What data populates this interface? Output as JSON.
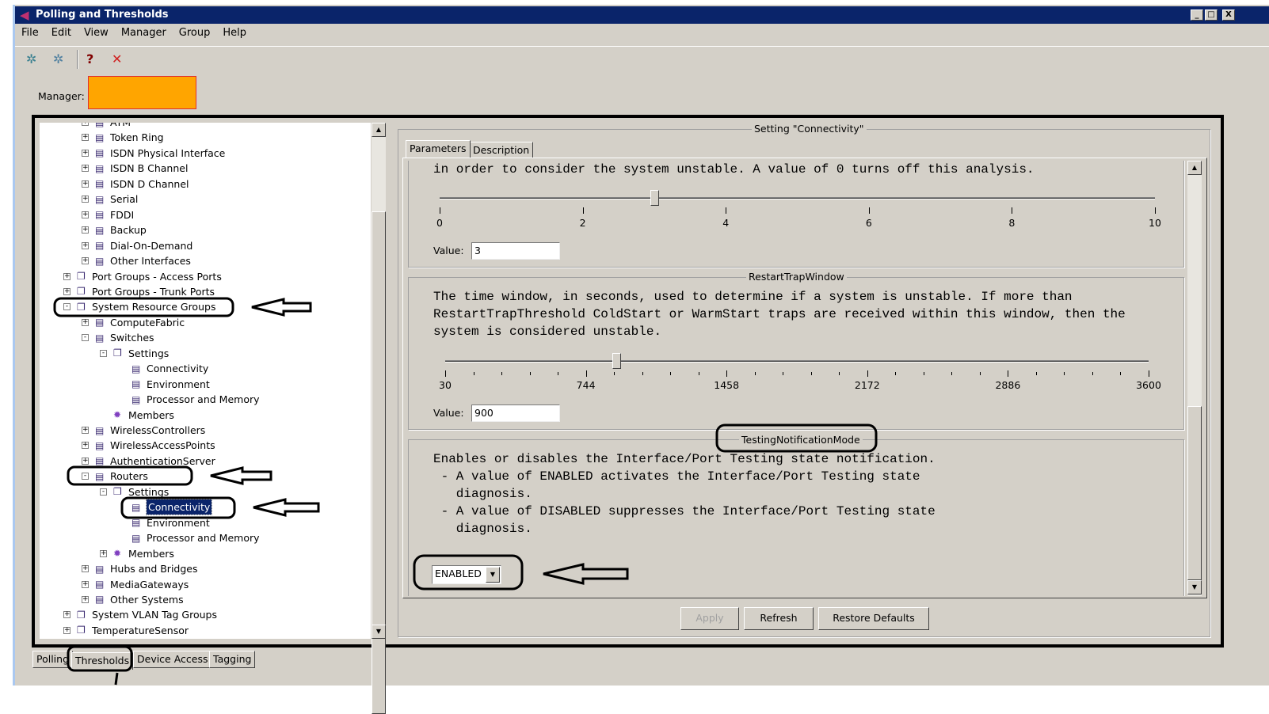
{
  "window": {
    "title": "Polling and Thresholds",
    "minimize": "_",
    "maximize": "□",
    "close": "X"
  },
  "menu": [
    "File",
    "Edit",
    "View",
    "Manager",
    "Group",
    "Help"
  ],
  "manager": {
    "label": "Manager:",
    "value": "",
    "redact_color": "#ffa500"
  },
  "tree": [
    {
      "label": "ATM",
      "level": 2,
      "exp": "+"
    },
    {
      "label": "Token Ring",
      "level": 2,
      "exp": "+"
    },
    {
      "label": "ISDN Physical Interface",
      "level": 2,
      "exp": "+"
    },
    {
      "label": "ISDN B Channel",
      "level": 2,
      "exp": "+"
    },
    {
      "label": "ISDN D Channel",
      "level": 2,
      "exp": "+"
    },
    {
      "label": "Serial",
      "level": 2,
      "exp": "+"
    },
    {
      "label": "FDDI",
      "level": 2,
      "exp": "+"
    },
    {
      "label": "Backup",
      "level": 2,
      "exp": "+"
    },
    {
      "label": "Dial-On-Demand",
      "level": 2,
      "exp": "+"
    },
    {
      "label": "Other Interfaces",
      "level": 2,
      "exp": "+"
    },
    {
      "label": "Port Groups - Access Ports",
      "level": 1,
      "exp": "+",
      "group": true
    },
    {
      "label": "Port Groups - Trunk Ports",
      "level": 1,
      "exp": "+",
      "group": true
    },
    {
      "label": "System Resource Groups",
      "level": 1,
      "exp": "-",
      "group": true
    },
    {
      "label": "ComputeFabric",
      "level": 2,
      "exp": "+"
    },
    {
      "label": "Switches",
      "level": 2,
      "exp": "-"
    },
    {
      "label": "Settings",
      "level": 3,
      "exp": "-",
      "group": true
    },
    {
      "label": "Connectivity",
      "level": 4,
      "exp": ""
    },
    {
      "label": "Environment",
      "level": 4,
      "exp": ""
    },
    {
      "label": "Processor and Memory",
      "level": 4,
      "exp": ""
    },
    {
      "label": "Members",
      "level": 3,
      "exp": "",
      "members": true
    },
    {
      "label": "WirelessControllers",
      "level": 2,
      "exp": "+"
    },
    {
      "label": "WirelessAccessPoints",
      "level": 2,
      "exp": "+"
    },
    {
      "label": "AuthenticationServer",
      "level": 2,
      "exp": "+"
    },
    {
      "label": "Routers",
      "level": 2,
      "exp": "-"
    },
    {
      "label": "Settings",
      "level": 3,
      "exp": "-",
      "group": true
    },
    {
      "label": "Connectivity",
      "level": 4,
      "exp": "",
      "selected": true
    },
    {
      "label": "Environment",
      "level": 4,
      "exp": ""
    },
    {
      "label": "Processor and Memory",
      "level": 4,
      "exp": ""
    },
    {
      "label": "Members",
      "level": 3,
      "exp": "+",
      "members": true
    },
    {
      "label": "Hubs and Bridges",
      "level": 2,
      "exp": "+"
    },
    {
      "label": "MediaGateways",
      "level": 2,
      "exp": "+"
    },
    {
      "label": "Other Systems",
      "level": 2,
      "exp": "+"
    },
    {
      "label": "System VLAN Tag Groups",
      "level": 1,
      "exp": "+",
      "group": true
    },
    {
      "label": "TemperatureSensor",
      "level": 1,
      "exp": "+",
      "group": true
    }
  ],
  "settings": {
    "title": "Setting \"Connectivity\"",
    "tabs": [
      "Parameters",
      "Description"
    ],
    "param1": {
      "desc": "in order to consider the system unstable. A value of 0 turns off this analysis.",
      "ticks": [
        "0",
        "2",
        "4",
        "6",
        "8",
        "10"
      ],
      "min": 0,
      "max": 10,
      "value_label": "Value:",
      "value": "3"
    },
    "param2": {
      "name": "RestartTrapWindow",
      "desc": [
        "The time window, in seconds, used to determine if a system is unstable. If more than",
        "RestartTrapThreshold ColdStart or WarmStart traps are received within this window, then the",
        "system is considered unstable."
      ],
      "ticks": [
        "30",
        "744",
        "1458",
        "2172",
        "2886",
        "3600"
      ],
      "min": 30,
      "max": 3600,
      "value_label": "Value:",
      "value": "900"
    },
    "param3": {
      "name": "TestingNotificationMode",
      "desc": [
        "Enables or disables the Interface/Port Testing state notification.",
        " - A value of ENABLED activates the Interface/Port Testing state",
        "   diagnosis.",
        " - A value of DISABLED suppresses the Interface/Port Testing state",
        "   diagnosis."
      ],
      "value": "ENABLED"
    },
    "buttons": {
      "apply": "Apply",
      "refresh": "Refresh",
      "restore": "Restore Defaults"
    }
  },
  "bottom_tabs": [
    "Polling",
    "Thresholds",
    "Device Access",
    "Tagging"
  ]
}
